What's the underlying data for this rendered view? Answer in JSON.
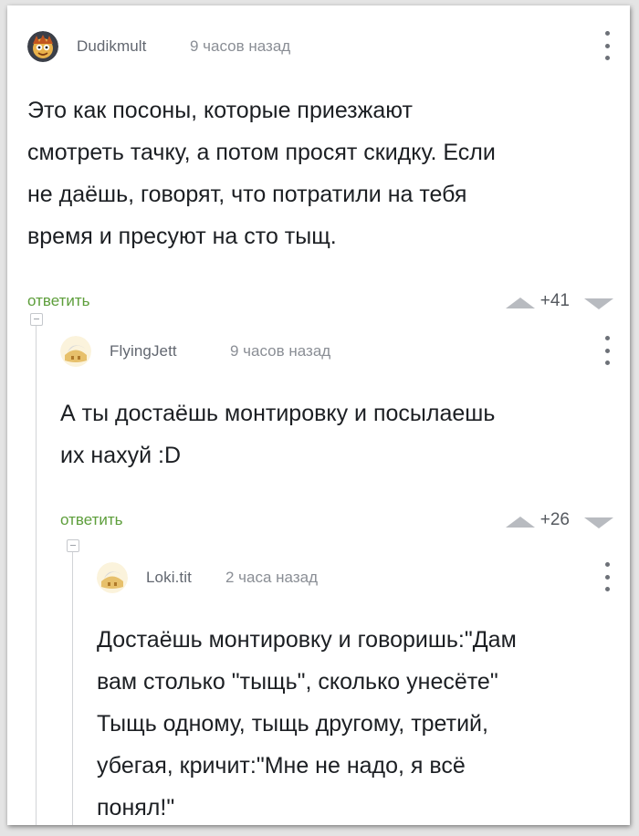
{
  "comments": [
    {
      "username": "Dudikmult",
      "time": "9 часов назад",
      "text": "Это как посоны, которые приезжают\nсмотреть тачку, а потом просят скидку. Если\nне даёшь, говорят, что потратили на тебя\nвремя и пресуют на сто тыщ.",
      "reply_label": "ответить",
      "rating": "+41",
      "avatar_icon": "cartoon-face-avatar"
    },
    {
      "username": "FlyingJett",
      "time": "9 часов назад",
      "text": "А ты достаёшь монтировку и посылаешь\nих нахуй :D",
      "reply_label": "ответить",
      "rating": "+26",
      "avatar_icon": "default-avatar"
    },
    {
      "username": "Loki.tit",
      "time": "2 часа назад",
      "text": "Достаёшь монтировку и говоришь:\"Дам\nвам столько \"тыщь\", сколько унесёте\"\nТыщь одному, тыщь другому, третий,\nубегая, кричит:\"Мне не надо, я всё\nпонял!\"",
      "avatar_icon": "default-avatar"
    }
  ],
  "colors": {
    "accent_green": "#5d9e3b",
    "text": "#1c1f23",
    "meta": "#8a8e95",
    "vote_arrow": "#b8bbc0"
  }
}
